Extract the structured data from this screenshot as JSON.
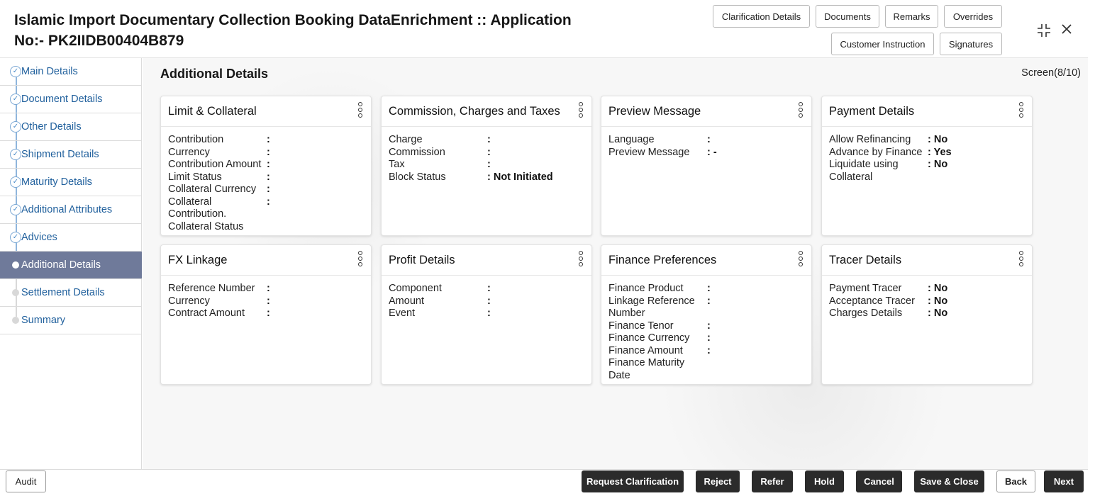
{
  "header": {
    "title": "Islamic Import Documentary Collection Booking DataEnrichment :: Application No:- PK2IIDB00404B879",
    "buttons": {
      "clarification": "Clarification Details",
      "documents": "Documents",
      "remarks": "Remarks",
      "overrides": "Overrides",
      "customer_instruction": "Customer Instruction",
      "signatures": "Signatures"
    },
    "icons": {
      "minimize": "minimize-icon",
      "close": "close-icon"
    }
  },
  "sidebar": {
    "items": [
      {
        "label": "Main Details",
        "state": "done"
      },
      {
        "label": "Document Details",
        "state": "done"
      },
      {
        "label": "Other Details",
        "state": "done"
      },
      {
        "label": "Shipment Details",
        "state": "done"
      },
      {
        "label": "Maturity Details",
        "state": "done"
      },
      {
        "label": "Additional Attributes",
        "state": "done"
      },
      {
        "label": "Advices",
        "state": "done"
      },
      {
        "label": "Additional Details",
        "state": "active"
      },
      {
        "label": "Settlement Details",
        "state": "pending"
      },
      {
        "label": "Summary",
        "state": "pending"
      }
    ]
  },
  "main": {
    "title": "Additional Details",
    "screen": "Screen(8/10)",
    "cards": [
      {
        "title": "Limit & Collateral",
        "rows": [
          {
            "k": "Contribution",
            "v": ":"
          },
          {
            "k": "Currency",
            "v": ":"
          },
          {
            "k": "Contribution Amount",
            "v": ":"
          },
          {
            "k": "Limit Status",
            "v": ":"
          },
          {
            "k": "Collateral Currency",
            "v": ":"
          },
          {
            "k": "Collateral Contribution.",
            "v": ":"
          },
          {
            "k": "Collateral Status",
            "v": ""
          }
        ]
      },
      {
        "title": "Commission, Charges and Taxes",
        "rows": [
          {
            "k": "Charge",
            "v": ":"
          },
          {
            "k": "Commission",
            "v": ":"
          },
          {
            "k": "Tax",
            "v": ":"
          },
          {
            "k": "Block Status",
            "v": ": Not Initiated"
          }
        ]
      },
      {
        "title": "Preview Message",
        "rows": [
          {
            "k": "Language",
            "v": ":"
          },
          {
            "k": "Preview Message",
            "v": ": -"
          }
        ]
      },
      {
        "title": "Payment Details",
        "rows": [
          {
            "k": "Allow Refinancing",
            "v": ": No"
          },
          {
            "k": "Advance by Finance",
            "v": ": Yes"
          },
          {
            "k": "Liquidate using Collateral",
            "v": ": No"
          }
        ]
      },
      {
        "title": "FX Linkage",
        "rows": [
          {
            "k": "Reference Number",
            "v": ":"
          },
          {
            "k": "Currency",
            "v": ":"
          },
          {
            "k": "Contract Amount",
            "v": ":"
          }
        ]
      },
      {
        "title": "Profit Details",
        "rows": [
          {
            "k": "Component",
            "v": ":"
          },
          {
            "k": "Amount",
            "v": ":"
          },
          {
            "k": "Event",
            "v": ":"
          }
        ]
      },
      {
        "title": "Finance Preferences",
        "rows": [
          {
            "k": "Finance Product",
            "v": ":"
          },
          {
            "k": "Linkage Reference Number",
            "v": ":"
          },
          {
            "k": "Finance Tenor",
            "v": ":"
          },
          {
            "k": "Finance Currency",
            "v": ":"
          },
          {
            "k": "Finance Amount",
            "v": ":"
          },
          {
            "k": "Finance Maturity Date",
            "v": ""
          }
        ]
      },
      {
        "title": "Tracer Details",
        "rows": [
          {
            "k": "Payment Tracer",
            "v": ": No"
          },
          {
            "k": "Acceptance Tracer",
            "v": ": No"
          },
          {
            "k": "Charges Details",
            "v": ": No"
          }
        ]
      }
    ]
  },
  "footer": {
    "audit": "Audit",
    "request_clarification": "Request Clarification",
    "reject": "Reject",
    "refer": "Refer",
    "hold": "Hold",
    "cancel": "Cancel",
    "save_close": "Save & Close",
    "back": "Back",
    "next": "Next"
  }
}
